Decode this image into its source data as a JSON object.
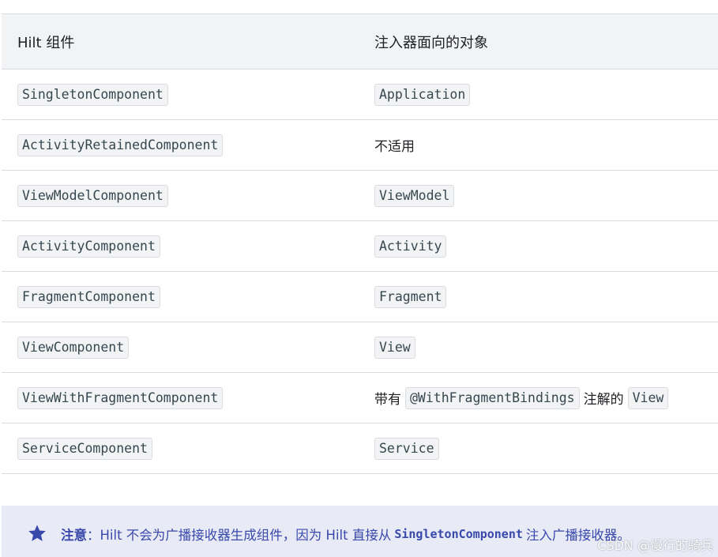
{
  "table": {
    "headers": [
      "Hilt 组件",
      "注入器面向的对象"
    ],
    "rows": [
      {
        "component": "SingletonComponent",
        "target_code": "Application"
      },
      {
        "component": "ActivityRetainedComponent",
        "target_text": "不适用"
      },
      {
        "component": "ViewModelComponent",
        "target_code": "ViewModel"
      },
      {
        "component": "ActivityComponent",
        "target_code": "Activity"
      },
      {
        "component": "FragmentComponent",
        "target_code": "Fragment"
      },
      {
        "component": "ViewComponent",
        "target_code": "View"
      },
      {
        "component": "ViewWithFragmentComponent",
        "target_prefix": "带有",
        "target_code_1": "@WithFragmentBindings",
        "target_middle": "注解的",
        "target_code_2": "View"
      },
      {
        "component": "ServiceComponent",
        "target_code": "Service"
      }
    ]
  },
  "note": {
    "icon": "star-icon",
    "label": "注意",
    "colon": "：",
    "text_before": "Hilt 不会为广播接收器生成组件，因为 Hilt 直接从",
    "code": "SingletonComponent",
    "text_after": "注入广播接收器。",
    "accent_color": "#3949ab",
    "background_color": "#e8eaf6"
  },
  "watermark": "CSDN @慢行的骑兵"
}
